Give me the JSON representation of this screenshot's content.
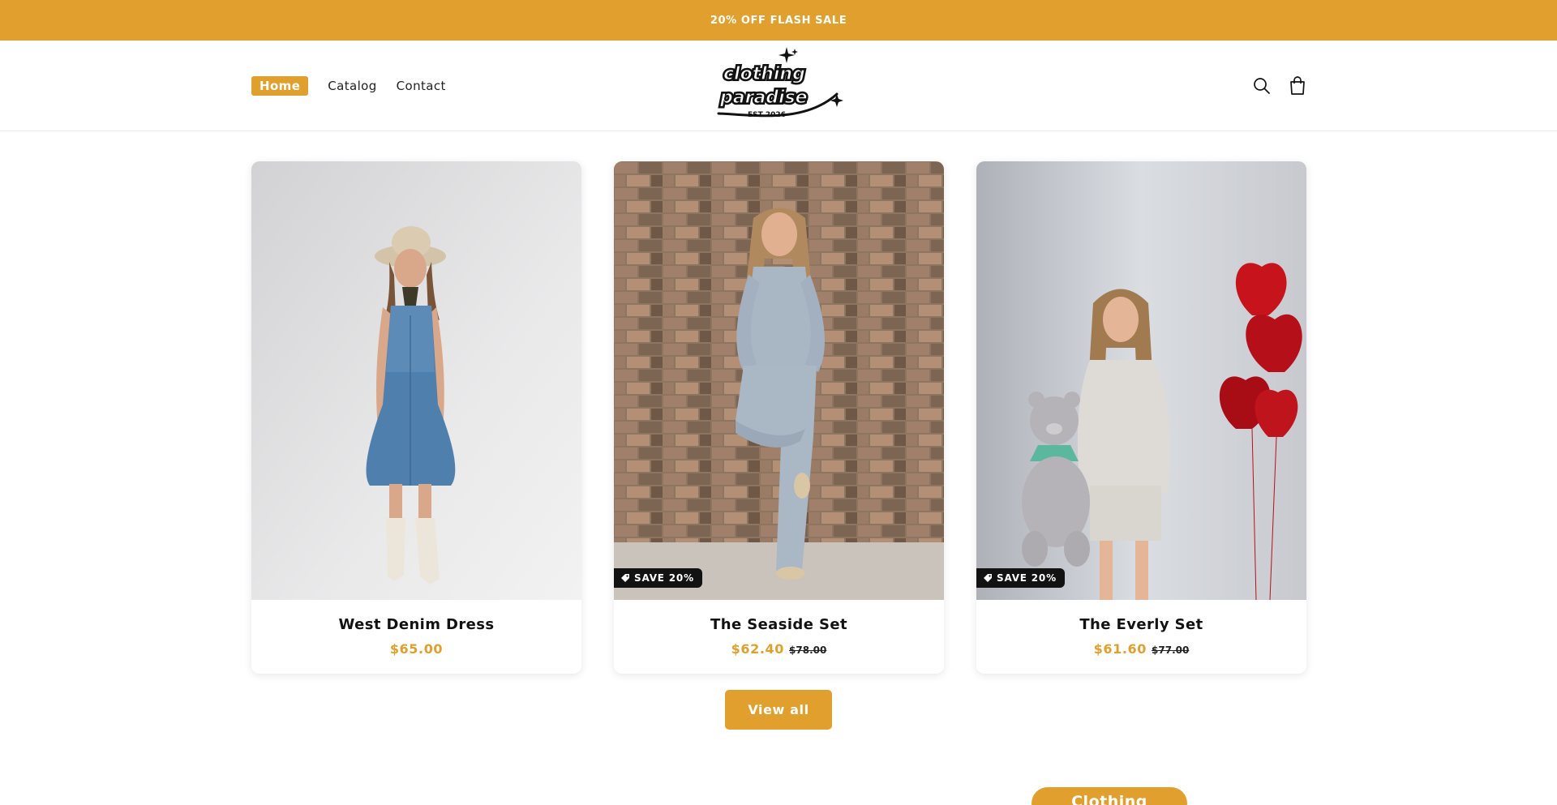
{
  "announcement": {
    "text": "20% OFF FLASH SALE"
  },
  "nav": {
    "items": [
      {
        "label": "Home",
        "active": true
      },
      {
        "label": "Catalog",
        "active": false
      },
      {
        "label": "Contact",
        "active": false
      }
    ]
  },
  "logo": {
    "line1": "clothing",
    "line2": "paradise",
    "line3": "EST 2026"
  },
  "header_icons": [
    "search-icon",
    "cart-icon"
  ],
  "products": [
    {
      "title": "West Denim Dress",
      "price": "$65.00",
      "compare_price": "",
      "badge": ""
    },
    {
      "title": "The Seaside Set",
      "price": "$62.40",
      "compare_price": "$78.00",
      "badge": "SAVE 20%"
    },
    {
      "title": "The Everly Set",
      "price": "$61.60",
      "compare_price": "$77.00",
      "badge": "SAVE 20%"
    }
  ],
  "view_all_label": "View all",
  "clothing_button_label": "Clothing",
  "colors": {
    "accent": "#e1a02d",
    "text": "#121212",
    "badge_bg": "#121212"
  }
}
